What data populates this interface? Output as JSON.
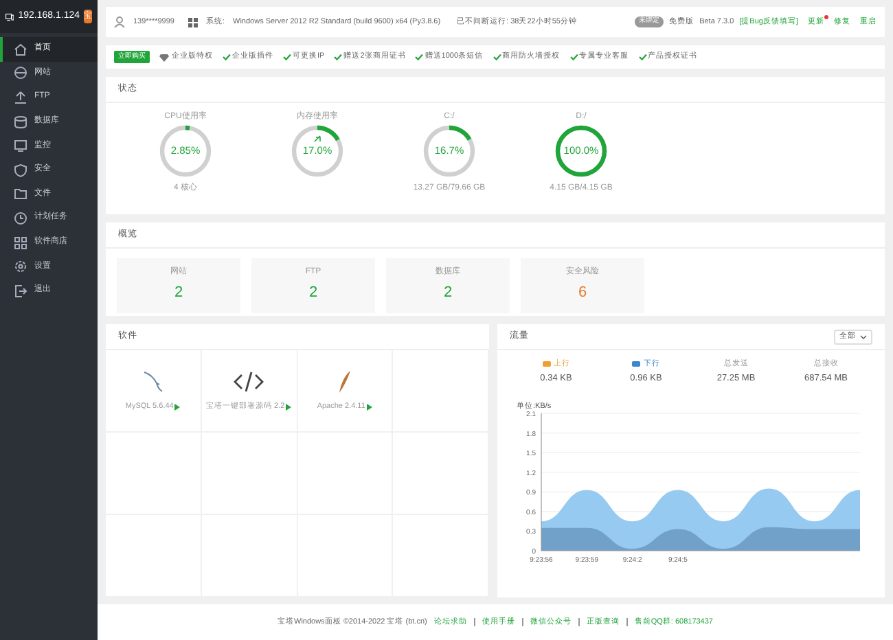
{
  "sidebar": {
    "host": "192.168.1.124",
    "badge": "宝",
    "items": [
      {
        "label": "首页",
        "kind": "home",
        "selected": true
      },
      {
        "label": "网站",
        "kind": "globe",
        "selected": false
      },
      {
        "label": "FTP",
        "kind": "ftp",
        "selected": false
      },
      {
        "label": "数据库",
        "kind": "db",
        "selected": false
      },
      {
        "label": "监控",
        "kind": "monitor",
        "selected": false
      },
      {
        "label": "安全",
        "kind": "shield",
        "selected": false
      },
      {
        "label": "文件",
        "kind": "folder",
        "selected": false
      },
      {
        "label": "计划任务",
        "kind": "clock",
        "selected": false
      },
      {
        "label": "软件商店",
        "kind": "grid",
        "selected": false
      },
      {
        "label": "设置",
        "kind": "gear",
        "selected": false
      },
      {
        "label": "退出",
        "kind": "exit",
        "selected": false
      }
    ]
  },
  "topbar": {
    "user": "139****9999",
    "system_label": "系统:",
    "system": "Windows Server 2012 R2 Standard (build 9600) x64 (Py3.8.6)",
    "uptime": "已不间断运行: 38天22小时55分钟",
    "badge": "未绑定",
    "edition": "免费版",
    "version": "Beta 7.3.0",
    "feedback": "[提Bug反馈填写]",
    "actions": [
      {
        "label": "更新",
        "dot": true
      },
      {
        "label": "修复",
        "dot": false
      },
      {
        "label": "重启",
        "dot": false
      }
    ]
  },
  "promo": {
    "button": "立即购买",
    "title": "企业版特权",
    "features": [
      "企业版插件",
      "可更换IP",
      "赠送2张商用证书",
      "赠送1000条短信",
      "商用防火墙授权",
      "专属专业客服",
      "产品授权证书"
    ]
  },
  "status": {
    "title": "状态",
    "gauges": [
      {
        "label": "CPU使用率",
        "value": "2.85%",
        "level": 0.0285,
        "detail": "4 核心"
      },
      {
        "label": "内存使用率",
        "value": "17.0%",
        "level": 0.17,
        "boost": true
      },
      {
        "label": "C:/",
        "value": "16.7%",
        "level": 0.167,
        "detail": "13.27 GB/79.66 GB"
      },
      {
        "label": "D:/",
        "value": "100.0%",
        "level": 1.0,
        "detail": "4.15 GB/4.15 GB"
      }
    ]
  },
  "overview": {
    "title": "概览",
    "cards": [
      {
        "label": "网站",
        "value": "2",
        "warn": false
      },
      {
        "label": "FTP",
        "value": "2",
        "warn": false
      },
      {
        "label": "数据库",
        "value": "2",
        "warn": false
      },
      {
        "label": "安全风险",
        "value": "6",
        "warn": true
      }
    ]
  },
  "software": {
    "title": "软件",
    "items": [
      {
        "name": "MySQL 5.6.44",
        "kind": "mysql"
      },
      {
        "name": "宝塔一键部署源码 2.2",
        "kind": "code"
      },
      {
        "name": "Apache 2.4.11",
        "kind": "feather"
      }
    ]
  },
  "traffic": {
    "title": "流量",
    "select": "全部",
    "stats": [
      {
        "label": "上行",
        "value": "0.34 KB",
        "kind": "up"
      },
      {
        "label": "下行",
        "value": "0.96 KB",
        "kind": "down"
      },
      {
        "label": "总发送",
        "value": "27.25 MB",
        "kind": "plain"
      },
      {
        "label": "总接收",
        "value": "687.54 MB",
        "kind": "plain"
      }
    ],
    "chart_data": {
      "type": "area",
      "ylabel": "单位:KB/s",
      "categories": [
        "9:23:56",
        "9:23:59",
        "9:24:2",
        "9:24:5",
        null,
        null,
        null,
        null
      ],
      "ylim": [
        0,
        2.1
      ],
      "grid": true,
      "yticks": [
        0,
        0.3,
        0.6,
        0.9,
        1.2,
        1.5,
        1.8,
        2.1
      ],
      "series": [
        {
          "color": "#8cc4f0",
          "values": [
            0.45,
            0.93,
            0.45,
            0.93,
            0.45,
            0.95,
            0.45,
            0.93
          ]
        },
        {
          "color": "#6d9bc3",
          "values": [
            0.35,
            0.35,
            0.03,
            0.33,
            0.03,
            0.36,
            0.33,
            0.33
          ]
        }
      ]
    }
  },
  "footer": {
    "copyright": "宝塔Windows面板 ©2014-2022 宝塔 (bt.cn)",
    "links": [
      "论坛求助",
      "使用手册",
      "微信公众号",
      "正版查询"
    ],
    "qq": "售前QQ群: 608173437"
  }
}
